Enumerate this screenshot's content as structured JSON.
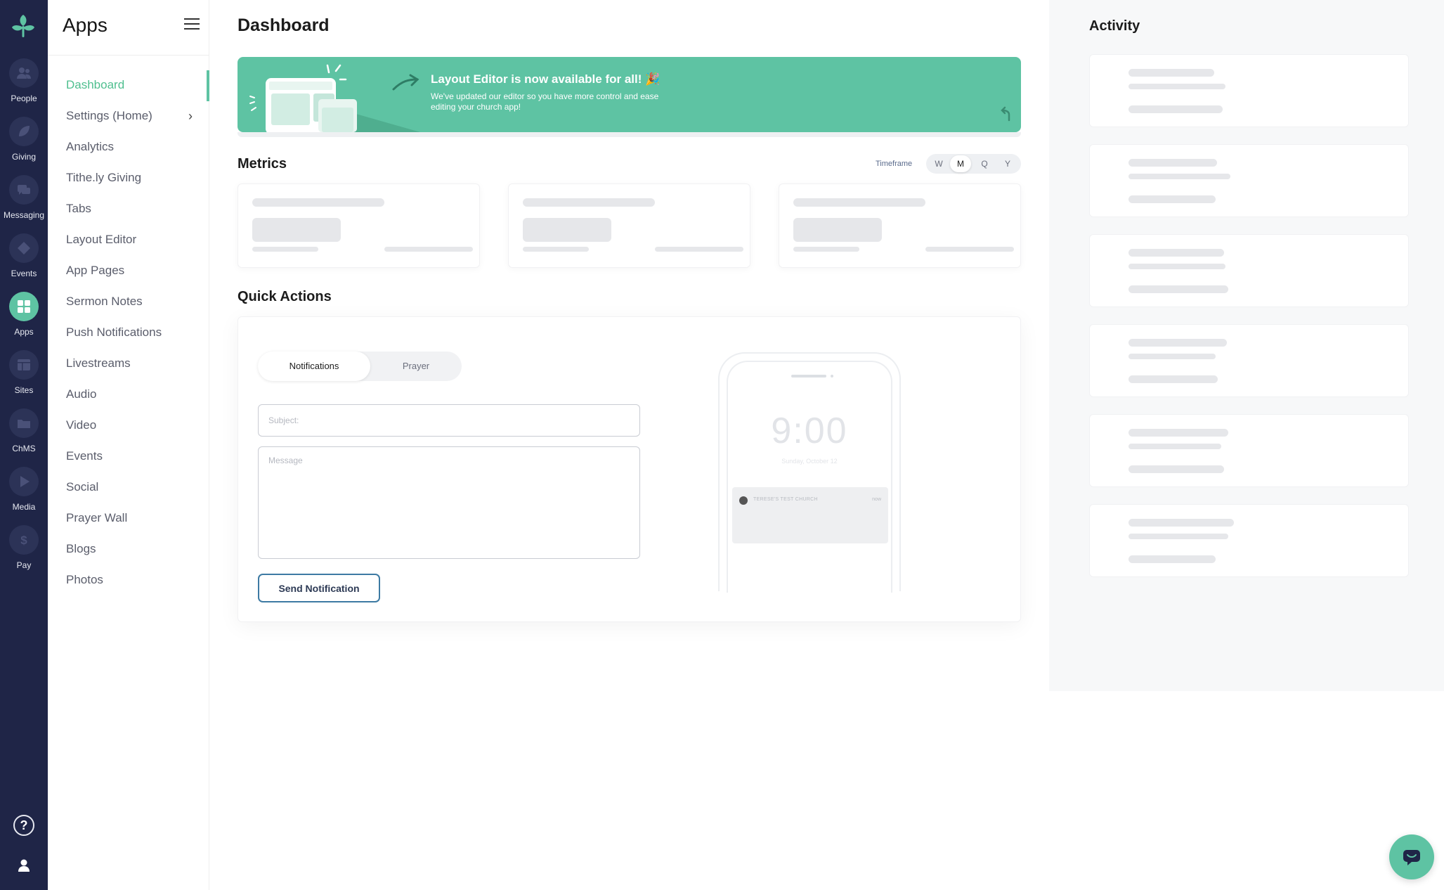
{
  "rail": {
    "items": [
      {
        "label": "People",
        "icon": "people-icon"
      },
      {
        "label": "Giving",
        "icon": "leaf-icon"
      },
      {
        "label": "Messaging",
        "icon": "chat-bubbles-icon"
      },
      {
        "label": "Events",
        "icon": "ticket-icon"
      },
      {
        "label": "Apps",
        "icon": "grid-icon"
      },
      {
        "label": "Sites",
        "icon": "layout-icon"
      },
      {
        "label": "ChMS",
        "icon": "folder-icon"
      },
      {
        "label": "Media",
        "icon": "play-icon"
      },
      {
        "label": "Pay",
        "icon": "dollar-icon"
      }
    ],
    "help_glyph": "?",
    "active_color": "#5ec3a3",
    "background": "#1f2547"
  },
  "sidebar": {
    "title": "Apps",
    "items": [
      {
        "label": "Dashboard"
      },
      {
        "label": "Settings (Home)",
        "chevron": "›"
      },
      {
        "label": "Analytics"
      },
      {
        "label": "Tithe.ly Giving"
      },
      {
        "label": "Tabs"
      },
      {
        "label": "Layout Editor"
      },
      {
        "label": "App Pages"
      },
      {
        "label": "Sermon Notes"
      },
      {
        "label": "Push Notifications"
      },
      {
        "label": "Livestreams"
      },
      {
        "label": "Audio"
      },
      {
        "label": "Video"
      },
      {
        "label": "Events"
      },
      {
        "label": "Social"
      },
      {
        "label": "Prayer Wall"
      },
      {
        "label": "Blogs"
      },
      {
        "label": "Photos"
      }
    ]
  },
  "main": {
    "title": "Dashboard",
    "banner": {
      "title": "Layout Editor is now available for all! 🎉",
      "description": "We've updated our editor so you have more control and ease editing your church app!"
    },
    "metrics": {
      "title": "Metrics",
      "timeframe_label": "Timeframe",
      "timeframe_options": [
        "W",
        "M",
        "Q",
        "Y"
      ],
      "timeframe_selected": "M"
    },
    "quick_actions": {
      "title": "Quick Actions",
      "tabs": [
        "Notifications",
        "Prayer"
      ],
      "subject_placeholder": "Subject:",
      "message_placeholder": "Message",
      "send_label": "Send Notification",
      "phone": {
        "time": "9:00",
        "date": "Sunday, October 12",
        "church": "TERESE'S TEST CHURCH",
        "stamp": "now"
      }
    }
  },
  "activity": {
    "title": "Activity"
  },
  "colors": {
    "accent": "#5ec3a3",
    "active_nav_text": "#4fbf8f",
    "button_border": "#3d7aa3"
  }
}
